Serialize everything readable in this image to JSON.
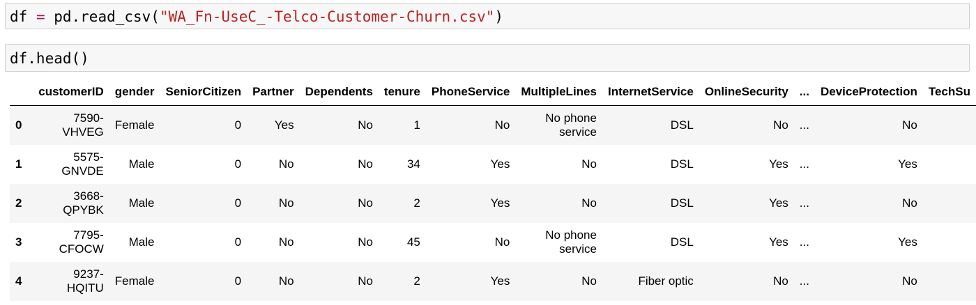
{
  "cells": [
    {
      "tokens": [
        {
          "text": "df",
          "kind": "var"
        },
        {
          "text": " = ",
          "kind": "op"
        },
        {
          "text": "pd.read_csv(",
          "kind": "punct"
        },
        {
          "text": "\"WA_Fn-UseC_-Telco-Customer-Churn.csv\"",
          "kind": "str"
        },
        {
          "text": ")",
          "kind": "punct"
        }
      ]
    },
    {
      "tokens": [
        {
          "text": "df.head()",
          "kind": "punct"
        }
      ]
    }
  ],
  "table": {
    "columns": [
      "customerID",
      "gender",
      "SeniorCitizen",
      "Partner",
      "Dependents",
      "tenure",
      "PhoneService",
      "MultipleLines",
      "InternetService",
      "OnlineSecurity",
      "...",
      "DeviceProtection",
      "TechSu"
    ],
    "rows": [
      {
        "index": "0",
        "cells": [
          "7590-VHVEG",
          "Female",
          "0",
          "Yes",
          "No",
          "1",
          "No",
          "No phone service",
          "DSL",
          "No",
          "...",
          "No",
          ""
        ]
      },
      {
        "index": "1",
        "cells": [
          "5575-GNVDE",
          "Male",
          "0",
          "No",
          "No",
          "34",
          "Yes",
          "No",
          "DSL",
          "Yes",
          "...",
          "Yes",
          ""
        ]
      },
      {
        "index": "2",
        "cells": [
          "3668-QPYBK",
          "Male",
          "0",
          "No",
          "No",
          "2",
          "Yes",
          "No",
          "DSL",
          "Yes",
          "...",
          "No",
          ""
        ]
      },
      {
        "index": "3",
        "cells": [
          "7795-CFOCW",
          "Male",
          "0",
          "No",
          "No",
          "45",
          "No",
          "No phone service",
          "DSL",
          "Yes",
          "...",
          "Yes",
          ""
        ]
      },
      {
        "index": "4",
        "cells": [
          "9237-HQITU",
          "Female",
          "0",
          "No",
          "No",
          "2",
          "Yes",
          "No",
          "Fiber optic",
          "No",
          "...",
          "No",
          ""
        ]
      }
    ]
  }
}
